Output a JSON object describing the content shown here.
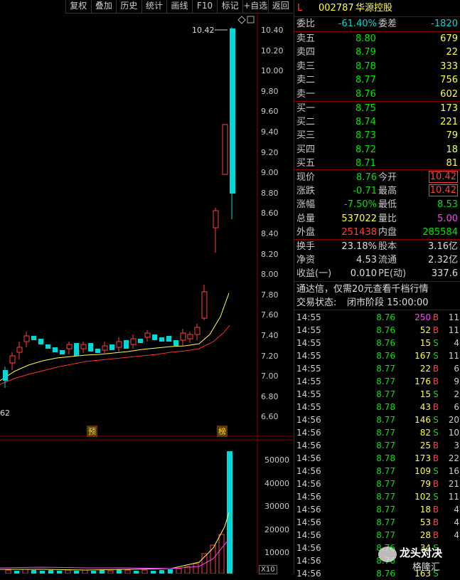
{
  "toolbar": [
    "复权",
    "叠加",
    "历史",
    "统计",
    "画线",
    "F10",
    "标记",
    "+自选",
    "返回"
  ],
  "chart": {
    "price_axis": [
      "10.40",
      "10.20",
      "10.00",
      "9.80",
      "9.60",
      "9.40",
      "9.20",
      "9.00",
      "8.80",
      "8.60",
      "8.40",
      "8.20",
      "8.00",
      "7.80",
      "7.60",
      "7.40",
      "7.20",
      "7.00",
      "6.80",
      "6.60"
    ],
    "high_label": "10.42",
    "low_label": "62",
    "marker_yu": "预",
    "marker_bang": "榜",
    "volume_axis": [
      "50000",
      "40000",
      "30000",
      "20000",
      "10000"
    ],
    "volume_unit": "X10"
  },
  "quote": {
    "header_l": "L",
    "code": "002787",
    "name": "华源控股",
    "weibi_label": "委比",
    "weibi": "-61.40%",
    "weicha_label": "委差",
    "weicha": "-1820",
    "sell": [
      {
        "label": "卖五",
        "price": "8.80",
        "vol": "679"
      },
      {
        "label": "卖四",
        "price": "8.79",
        "vol": "22"
      },
      {
        "label": "卖三",
        "price": "8.78",
        "vol": "333"
      },
      {
        "label": "卖二",
        "price": "8.77",
        "vol": "756"
      },
      {
        "label": "卖一",
        "price": "8.76",
        "vol": "602"
      }
    ],
    "buy": [
      {
        "label": "买一",
        "price": "8.75",
        "vol": "173"
      },
      {
        "label": "买二",
        "price": "8.74",
        "vol": "221"
      },
      {
        "label": "买三",
        "price": "8.73",
        "vol": "79"
      },
      {
        "label": "买四",
        "price": "8.72",
        "vol": "18"
      },
      {
        "label": "买五",
        "price": "8.71",
        "vol": "81"
      }
    ],
    "stats": [
      {
        "l1": "现价",
        "v1": "8.76",
        "l2": "今开",
        "v2": "10.42"
      },
      {
        "l1": "涨跌",
        "v1": "-0.71",
        "l2": "最高",
        "v2": "10.42"
      },
      {
        "l1": "涨幅",
        "v1": "-7.50%",
        "l2": "最低",
        "v2": "8.53"
      },
      {
        "l1": "总量",
        "v1": "537022",
        "l2": "量比",
        "v2": "5.00"
      },
      {
        "l1": "外盘",
        "v1": "251438",
        "l2": "内盘",
        "v2": "285584"
      }
    ],
    "stats2": [
      {
        "l1": "换手",
        "v1": "23.18%",
        "l2": "股本",
        "v2": "3.16亿"
      },
      {
        "l1": "净资",
        "v1": "4.53",
        "l2": "流通",
        "v2": "2.32亿"
      },
      {
        "l1": "收益(一)",
        "v1": "0.010",
        "l2": "PE(动)",
        "v2": "337.6"
      }
    ],
    "promo": "通达信，仅需20元查看千档行情",
    "status_label": "交易状态:",
    "status_value": "闭市阶段 15:00:00",
    "ticks": [
      {
        "t": "14:55",
        "p": "8.76",
        "v": "250",
        "bs": "B",
        "n": "11"
      },
      {
        "t": "14:55",
        "p": "8.76",
        "v": "52",
        "bs": "B",
        "n": "11"
      },
      {
        "t": "14:55",
        "p": "8.76",
        "v": "15",
        "bs": "S",
        "n": "4"
      },
      {
        "t": "14:55",
        "p": "8.76",
        "v": "167",
        "bs": "S",
        "n": "11"
      },
      {
        "t": "14:55",
        "p": "8.77",
        "v": "22",
        "bs": "B",
        "n": "6"
      },
      {
        "t": "14:55",
        "p": "8.77",
        "v": "176",
        "bs": "B",
        "n": "9"
      },
      {
        "t": "14:55",
        "p": "8.77",
        "v": "15",
        "bs": "S",
        "n": "2"
      },
      {
        "t": "14:55",
        "p": "8.78",
        "v": "43",
        "bs": "B",
        "n": "6"
      },
      {
        "t": "14:56",
        "p": "8.77",
        "v": "146",
        "bs": "S",
        "n": "20"
      },
      {
        "t": "14:56",
        "p": "8.77",
        "v": "82",
        "bs": "S",
        "n": "10"
      },
      {
        "t": "14:56",
        "p": "8.77",
        "v": "25",
        "bs": "B",
        "n": "3"
      },
      {
        "t": "14:56",
        "p": "8.78",
        "v": "173",
        "bs": "B",
        "n": "22"
      },
      {
        "t": "14:56",
        "p": "8.77",
        "v": "109",
        "bs": "S",
        "n": "16"
      },
      {
        "t": "14:56",
        "p": "8.77",
        "v": "79",
        "bs": "B",
        "n": "21"
      },
      {
        "t": "14:56",
        "p": "8.77",
        "v": "102",
        "bs": "S",
        "n": "11"
      },
      {
        "t": "14:56",
        "p": "8.77",
        "v": "18",
        "bs": "B",
        "n": "4"
      },
      {
        "t": "14:56",
        "p": "8.77",
        "v": "53",
        "bs": "B",
        "n": "4"
      },
      {
        "t": "14:56",
        "p": "8.77",
        "v": "28",
        "bs": "B",
        "n": "4"
      },
      {
        "t": "14:56",
        "p": "8.76",
        "v": "34",
        "bs": "S",
        "n": ""
      },
      {
        "t": "14:56",
        "p": "8.76",
        "v": "",
        "bs": "",
        "n": ""
      },
      {
        "t": "14:56",
        "p": "8.76",
        "v": "163",
        "bs": "S",
        "n": ""
      }
    ],
    "watermark_line1": "龙头对决",
    "watermark_line2": "格隆汇"
  },
  "colors": {
    "up": "#ff4040",
    "down": "#00d8d8",
    "green": "#00e600",
    "bg": "#000000",
    "grid": "#8b0000",
    "ma5": "#ffff40",
    "ma10": "#ff3030"
  }
}
